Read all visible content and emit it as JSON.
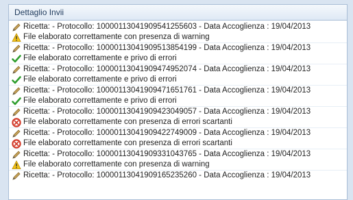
{
  "panel": {
    "title": "Dettaglio Invii"
  },
  "rows": [
    {
      "icon": "pen-icon",
      "text": "Ricetta:  - Protocollo: 1000011304190954125560​3 - Data Accoglienza : 19/04/2013"
    },
    {
      "icon": "warning-icon",
      "text": "File elaborato correttamente con presenza di warning"
    },
    {
      "icon": "pen-icon",
      "text": "Ricetta:  - Protocollo: 1000011304190951385419​9 - Data Accoglienza : 19/04/2013"
    },
    {
      "icon": "check-icon",
      "text": "File elaborato correttamente e privo di errori"
    },
    {
      "icon": "pen-icon",
      "text": "Ricetta:  - Protocollo: 1000011304190947495207​4 - Data Accoglienza : 19/04/2013"
    },
    {
      "icon": "check-icon",
      "text": "File elaborato correttamente e privo di errori"
    },
    {
      "icon": "pen-icon",
      "text": "Ricetta:  - Protocollo: 1000011304190947165176​1 - Data Accoglienza : 19/04/2013"
    },
    {
      "icon": "check-icon",
      "text": "File elaborato correttamente e privo di errori"
    },
    {
      "icon": "pen-icon",
      "text": "Ricetta:  - Protocollo: 1000011304190942304905​7 - Data Accoglienza : 19/04/2013"
    },
    {
      "icon": "error-icon",
      "text": "File elaborato correttamente con presenza di errori scartanti"
    },
    {
      "icon": "pen-icon",
      "text": "Ricetta:  - Protocollo: 1000011304190942274900​9 - Data Accoglienza : 19/04/2013"
    },
    {
      "icon": "error-icon",
      "text": "File elaborato correttamente con presenza di errori scartanti"
    },
    {
      "icon": "pen-icon",
      "text": "Ricetta:  - Protocollo: 1000011304190933104376​5 - Data Accoglienza : 19/04/2013"
    },
    {
      "icon": "warning-icon",
      "text": "File elaborato correttamente con presenza di warning"
    },
    {
      "icon": "pen-icon",
      "text": "Ricetta:  - Protocollo: 1000011304190916523526​0 - Data Accoglienza : 19/04/2013"
    }
  ]
}
